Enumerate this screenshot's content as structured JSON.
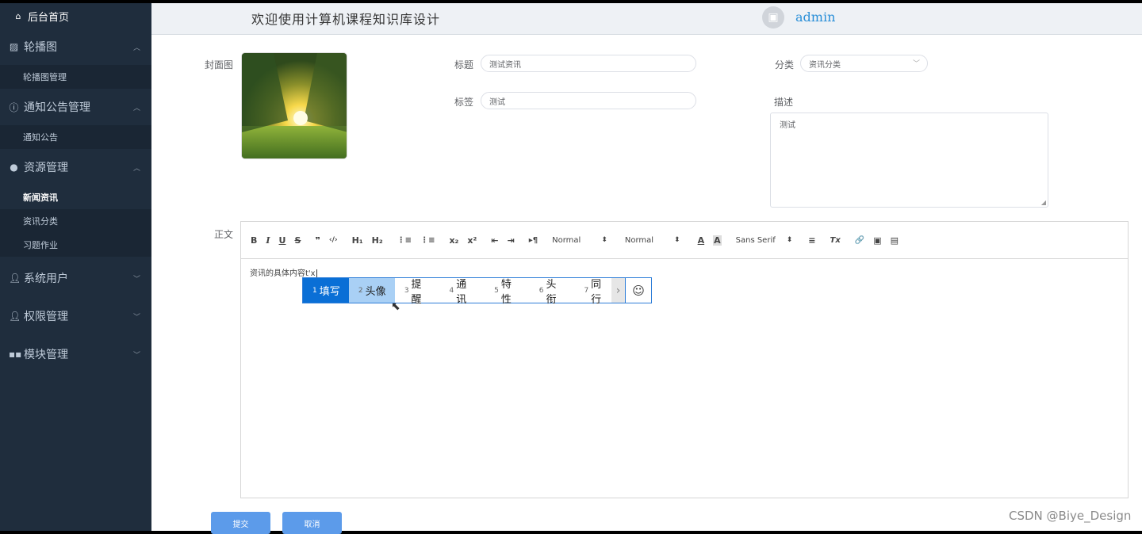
{
  "sidebar": {
    "home": "后台首页",
    "groups": [
      {
        "label": "轮播图",
        "icon": "picture-icon",
        "expanded": true,
        "items": [
          "轮播图管理"
        ]
      },
      {
        "label": "通知公告管理",
        "icon": "info-circle-icon",
        "expanded": true,
        "items": [
          "通知公告"
        ]
      },
      {
        "label": "资源管理",
        "icon": "location-pin-icon",
        "expanded": true,
        "items": [
          "新闻资讯",
          "资讯分类",
          "习题作业"
        ],
        "active": "新闻资讯"
      },
      {
        "label": "系统用户",
        "icon": "user-icon",
        "expanded": false
      },
      {
        "label": "权限管理",
        "icon": "user-icon",
        "expanded": false
      },
      {
        "label": "模块管理",
        "icon": "grid-icon",
        "expanded": false
      }
    ]
  },
  "header": {
    "title": "欢迎使用计算机课程知识库设计",
    "username": "admin"
  },
  "form": {
    "cover_label": "封面图",
    "title_label": "标题",
    "title_value": "测试资讯",
    "category_label": "分类",
    "category_value": "资讯分类",
    "tag_label": "标签",
    "tag_value": "测试",
    "desc_label": "描述",
    "desc_value": "测试",
    "body_label": "正文",
    "body_value": "资讯的具体内容t'x",
    "submit": "提交",
    "cancel": "取消"
  },
  "editor_toolbar": {
    "bold": "B",
    "italic": "I",
    "underline": "U",
    "strike": "S",
    "quote": "❞",
    "code": "‹/›",
    "h1": "H₁",
    "h2": "H₂",
    "ol": "⋮≡",
    "ul": "⋮≡",
    "sub": "x₂",
    "sup": "x²",
    "outdent": "⇤",
    "indent": "⇥",
    "direction": "▸¶",
    "size": "Normal",
    "header": "Normal",
    "font": "Sans Serif",
    "color": "A",
    "background": "A",
    "align": "≡",
    "clean": "Tx",
    "link": "🔗",
    "image": "▣",
    "video": "▤"
  },
  "ime": {
    "candidates": [
      {
        "n": "1",
        "text": "填写"
      },
      {
        "n": "2",
        "text": "头像"
      },
      {
        "n": "3",
        "text": "提醒"
      },
      {
        "n": "4",
        "text": "通讯"
      },
      {
        "n": "5",
        "text": "特性"
      },
      {
        "n": "6",
        "text": "头衔"
      },
      {
        "n": "7",
        "text": "同行"
      }
    ]
  },
  "watermark": "CSDN @Biye_Design"
}
